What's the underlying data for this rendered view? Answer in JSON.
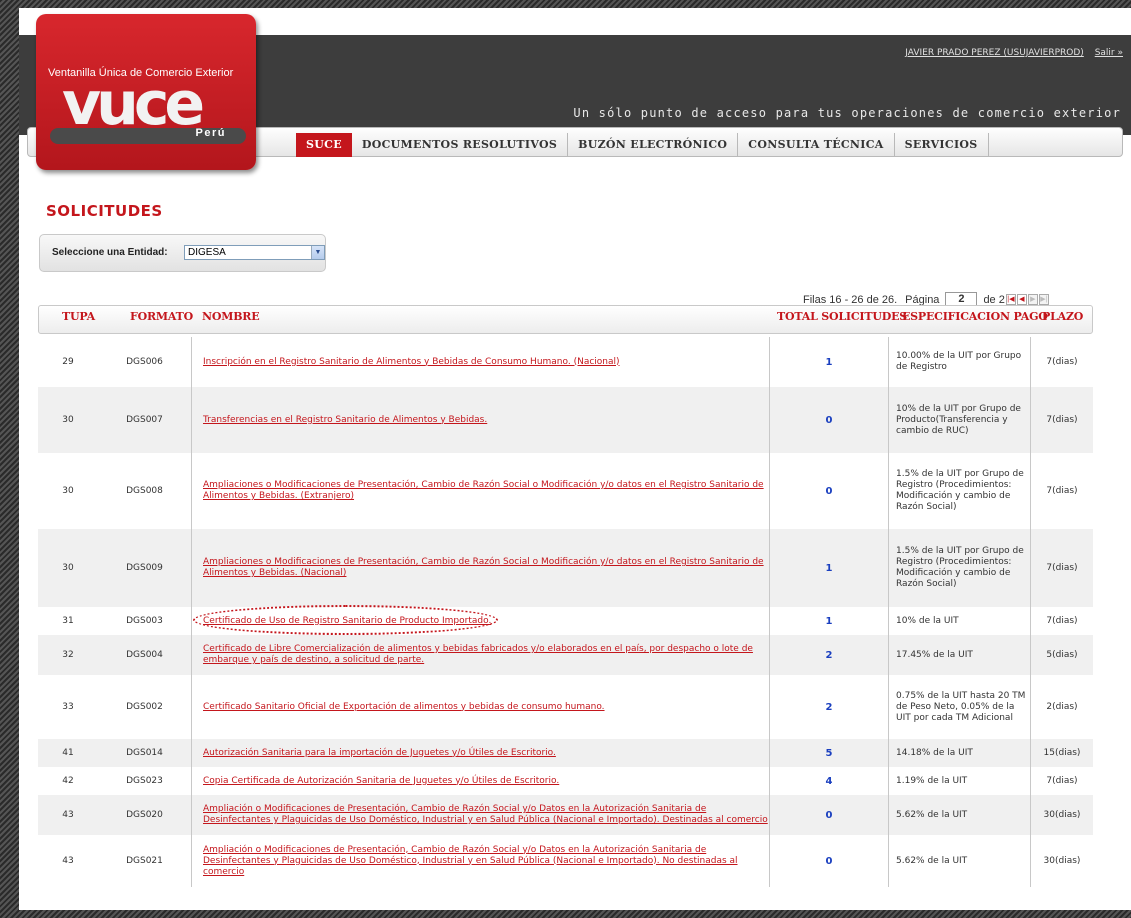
{
  "header": {
    "user_link": "JAVIER PRADO PEREZ (USUJAVIERPROD)",
    "logout_link": "Salir »",
    "tagline": "Un sólo punto de acceso para tus operaciones de comercio exterior"
  },
  "logo": {
    "top_text": "Ventanilla Única de Comercio Exterior",
    "wordmark": "vuce",
    "country": "Perú"
  },
  "nav": {
    "items": [
      "SUCE",
      "DOCUMENTOS RESOLUTIVOS",
      "BUZÓN ELECTRÓNICO",
      "CONSULTA TÉCNICA",
      "SERVICIOS"
    ],
    "active": "SUCE"
  },
  "page_title": "SOLICITUDES",
  "entity_filter": {
    "label": "Seleccione una Entidad:",
    "selected": "DIGESA"
  },
  "pager": {
    "rows_text": "Filas 16 - 26 de 26.",
    "page_label": "Página",
    "current_page": "2",
    "total_text": "de 2"
  },
  "table": {
    "columns": [
      "TUPA",
      "FORMATO",
      "NOMBRE",
      "TOTAL SOLICITUDES",
      "ESPECIFICACION PAGO",
      "PLAZO"
    ],
    "rows": [
      {
        "tupa": "29",
        "formato": "DGS006",
        "nombre": "Inscripción en el Registro Sanitario de Alimentos y Bebidas de Consumo Humano. (Nacional)",
        "total": "1",
        "spec": "10.00% de la UIT por Grupo de Registro",
        "plazo": "7(dias)"
      },
      {
        "tupa": "30",
        "formato": "DGS007",
        "nombre": "Transferencias en el Registro Sanitario de Alimentos y Bebidas.",
        "total": "0",
        "spec": "10% de la UIT por Grupo de Producto(Transferencia y cambio de RUC)",
        "plazo": "7(dias)"
      },
      {
        "tupa": "30",
        "formato": "DGS008",
        "nombre": "Ampliaciones o Modificaciones de Presentación, Cambio de Razón Social o Modificación y/o datos en el Registro Sanitario de Alimentos y Bebidas. (Extranjero)",
        "total": "0",
        "spec": "1.5% de la UIT por Grupo de Registro (Procedimientos: Modificación y cambio de Razón Social)",
        "plazo": "7(dias)"
      },
      {
        "tupa": "30",
        "formato": "DGS009",
        "nombre": "Ampliaciones o Modificaciones de Presentación, Cambio de Razón Social o Modificación y/o datos en el Registro Sanitario de Alimentos y Bebidas. (Nacional)",
        "total": "1",
        "spec": "1.5% de la UIT por Grupo de Registro (Procedimientos: Modificación y cambio de Razón Social)",
        "plazo": "7(dias)"
      },
      {
        "tupa": "31",
        "formato": "DGS003",
        "nombre": "Certificado de Uso de Registro Sanitario de Producto Importado.",
        "total": "1",
        "spec": "10% de la UIT",
        "plazo": "7(dias)"
      },
      {
        "tupa": "32",
        "formato": "DGS004",
        "nombre": "Certificado de Libre Comercialización de alimentos y bebidas fabricados y/o elaborados en el país, por despacho o lote de embarque y país de destino, a solicitud de parte.",
        "total": "2",
        "spec": "17.45% de la UIT",
        "plazo": "5(dias)"
      },
      {
        "tupa": "33",
        "formato": "DGS002",
        "nombre": "Certificado Sanitario Oficial de Exportación de alimentos y bebidas de consumo humano.",
        "total": "2",
        "spec": "0.75% de la UIT hasta 20 TM de Peso Neto, 0.05% de la UIT por cada TM Adicional",
        "plazo": "2(dias)"
      },
      {
        "tupa": "41",
        "formato": "DGS014",
        "nombre": "Autorización Sanitaria para la importación de Juguetes y/o Útiles de Escritorio.",
        "total": "5",
        "spec": "14.18% de la UIT",
        "plazo": "15(dias)"
      },
      {
        "tupa": "42",
        "formato": "DGS023",
        "nombre": "Copia Certificada de Autorización Sanitaria de Juguetes y/o Útiles de Escritorio.",
        "total": "4",
        "spec": "1.19% de la UIT",
        "plazo": "7(dias)"
      },
      {
        "tupa": "43",
        "formato": "DGS020",
        "nombre": "Ampliación o Modificaciones de Presentación, Cambio de Razón Social y/o Datos en la Autorización Sanitaria de Desinfectantes y Plaguicidas de Uso Doméstico, Industrial y en Salud Pública (Nacional e Importado). Destinadas al comercio",
        "total": "0",
        "spec": "5.62% de la UIT",
        "plazo": "30(dias)"
      },
      {
        "tupa": "43",
        "formato": "DGS021",
        "nombre": "Ampliación o Modificaciones de Presentación, Cambio de Razón Social y/o Datos en la Autorización Sanitaria de Desinfectantes y Plaguicidas de Uso Doméstico, Industrial y en Salud Pública (Nacional e Importado). No destinadas al comercio",
        "total": "0",
        "spec": "5.62% de la UIT",
        "plazo": "30(dias)"
      }
    ]
  },
  "colors": {
    "brand_red": "#c4161c",
    "header_dark": "#3d3d3d",
    "count_blue": "#1a3fbf"
  }
}
